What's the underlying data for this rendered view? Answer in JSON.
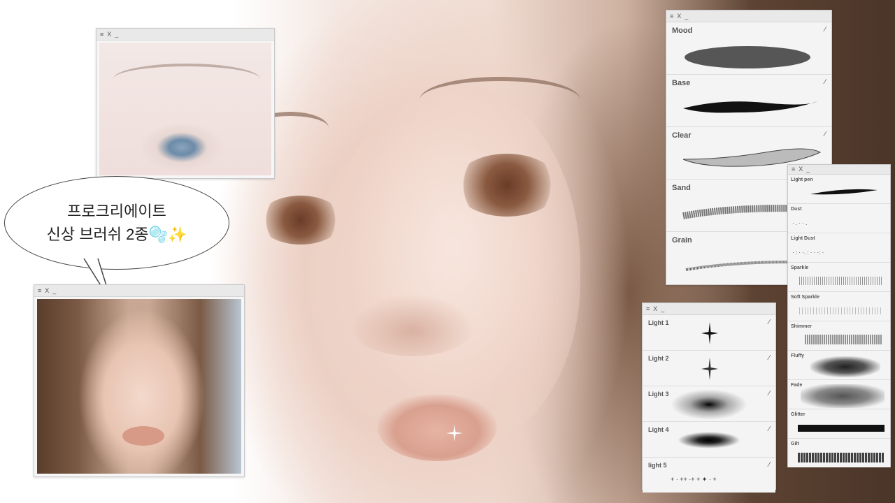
{
  "speech_bubble": {
    "line1": "프로크리에이트",
    "line2": "신상 브러쉬 2종🫧✨"
  },
  "window_controls": {
    "menu_icon": "≡",
    "close_icon": "X",
    "minimize_icon": "_"
  },
  "brush_panel_large": {
    "items": [
      {
        "label": "Mood"
      },
      {
        "label": "Base"
      },
      {
        "label": "Clear"
      },
      {
        "label": "Sand"
      },
      {
        "label": "Grain"
      }
    ]
  },
  "brush_panel_light": {
    "items": [
      {
        "label": "Light 1"
      },
      {
        "label": "Light 2"
      },
      {
        "label": "Light 3"
      },
      {
        "label": "Light 4"
      },
      {
        "label": "light 5"
      }
    ]
  },
  "brush_panel_small": {
    "items": [
      {
        "label": "Light pen"
      },
      {
        "label": "Dust"
      },
      {
        "label": "Light Dust"
      },
      {
        "label": "Sparkle"
      },
      {
        "label": "Soft Sparkle"
      },
      {
        "label": "Shimmer"
      },
      {
        "label": "Fluffy"
      },
      {
        "label": "Fade"
      },
      {
        "label": "Glitter"
      },
      {
        "label": "Gilt"
      }
    ]
  },
  "colors": {
    "panel_bg": "#f4f4f4",
    "titlebar_bg": "#e9e9e9",
    "label_text": "#555555",
    "hair_brown": "#5d4333"
  }
}
